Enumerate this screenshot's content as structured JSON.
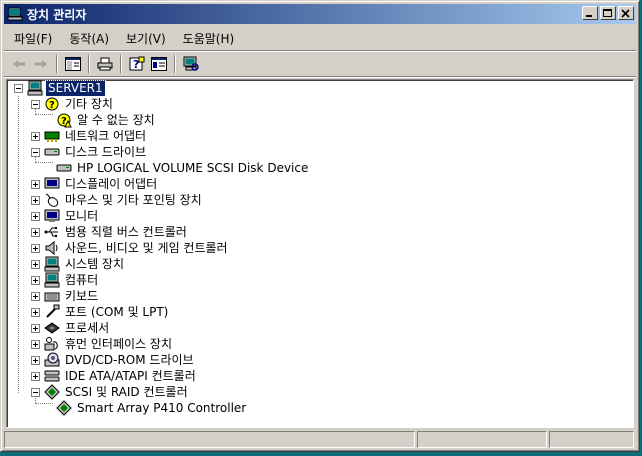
{
  "window": {
    "title": "장치 관리자"
  },
  "menu": [
    "파일(F)",
    "동작(A)",
    "보기(V)",
    "도움말(H)"
  ],
  "toolbar": [
    "back-icon",
    "forward-icon",
    "show-hide-tree-icon",
    "print-icon",
    "help-icon",
    "properties-icon",
    "scan-hardware-icon"
  ],
  "tree": {
    "root": "SERVER1",
    "other_devices": "기타 장치",
    "unknown_device": "알 수 없는 장치",
    "network_adapters": "네트워크 어댑터",
    "disk_drives": "디스크 드라이브",
    "disk_device": "HP LOGICAL VOLUME SCSI Disk Device",
    "display_adapters": "디스플레이 어댑터",
    "mice": "마우스 및 기타 포인팅 장치",
    "monitors": "모니터",
    "usb": "범용 직렬 버스 컨트롤러",
    "sound": "사운드, 비디오 및 게임 컨트롤러",
    "system_devices": "시스템 장치",
    "computer": "컴퓨터",
    "keyboards": "키보드",
    "ports": "포트 (COM 및 LPT)",
    "processors": "프로세서",
    "hid": "휴먼 인터페이스 장치",
    "dvd": "DVD/CD-ROM 드라이브",
    "ide": "IDE ATA/ATAPI 컨트롤러",
    "scsi": "SCSI 및 RAID 컨트롤러",
    "smart_array": "Smart Array P410 Controller"
  },
  "colors": {
    "titlebar_start": "#0a246a",
    "titlebar_end": "#a6caf0",
    "selection": "#0a246a",
    "desktop": "#0e6c78"
  }
}
